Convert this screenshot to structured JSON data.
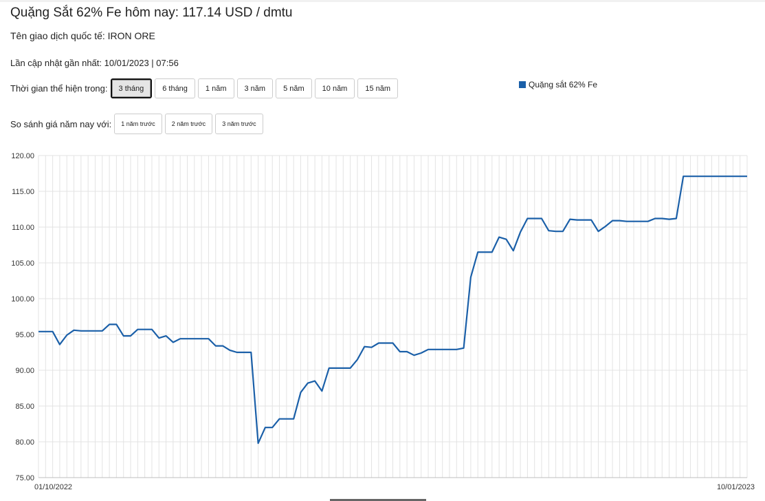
{
  "header": {
    "title": "Quặng Sắt 62% Fe hôm nay: 117.14 USD / dmtu",
    "intl_name": "Tên giao dịch quốc tế: IRON ORE",
    "last_updated": "Lần cập nhật gần nhất: 10/01/2023 | 07:56"
  },
  "period": {
    "label": "Thời gian thể hiện trong:",
    "options": [
      "3 tháng",
      "6 tháng",
      "1 năm",
      "3 năm",
      "5 năm",
      "10 năm",
      "15 năm"
    ],
    "selected": "3 tháng"
  },
  "compare": {
    "label": "So sánh giá năm nay với:",
    "options": [
      "1 năm trước",
      "2 năm trước",
      "3 năm trước"
    ]
  },
  "chart_data": {
    "type": "line",
    "title": "",
    "xlabel": "",
    "ylabel": "",
    "x_start_label": "01/10/2022",
    "x_end_label": "10/01/2023",
    "ylim": [
      75,
      120
    ],
    "yticks": [
      "75.00",
      "80.00",
      "85.00",
      "90.00",
      "95.00",
      "100.00",
      "105.00",
      "110.00",
      "115.00",
      "120.00"
    ],
    "grid": true,
    "legend_position": "top-right",
    "series": [
      {
        "name": "Quặng sắt 62% Fe",
        "color": "#1a5fa8",
        "values": [
          95.4,
          95.4,
          95.4,
          93.6,
          94.9,
          95.6,
          95.5,
          95.5,
          95.5,
          95.5,
          96.4,
          96.4,
          94.8,
          94.8,
          95.7,
          95.7,
          95.7,
          94.5,
          94.8,
          93.9,
          94.4,
          94.4,
          94.4,
          94.4,
          94.4,
          93.4,
          93.4,
          92.8,
          92.5,
          92.5,
          92.5,
          79.8,
          82.0,
          82.0,
          83.2,
          83.2,
          83.2,
          86.9,
          88.2,
          88.5,
          87.1,
          90.3,
          90.3,
          90.3,
          90.3,
          91.5,
          93.3,
          93.2,
          93.8,
          93.8,
          93.8,
          92.6,
          92.6,
          92.1,
          92.4,
          92.9,
          92.9,
          92.9,
          92.9,
          92.9,
          93.1,
          103.0,
          106.5,
          106.5,
          106.5,
          108.6,
          108.3,
          106.7,
          109.3,
          111.2,
          111.2,
          111.2,
          109.5,
          109.4,
          109.4,
          111.1,
          111.0,
          111.0,
          111.0,
          109.4,
          110.1,
          110.9,
          110.9,
          110.8,
          110.8,
          110.8,
          110.8,
          111.2,
          111.2,
          111.1,
          111.2,
          117.1,
          117.1,
          117.1,
          117.1,
          117.1,
          117.1,
          117.1,
          117.1,
          117.1,
          117.1
        ]
      }
    ]
  }
}
